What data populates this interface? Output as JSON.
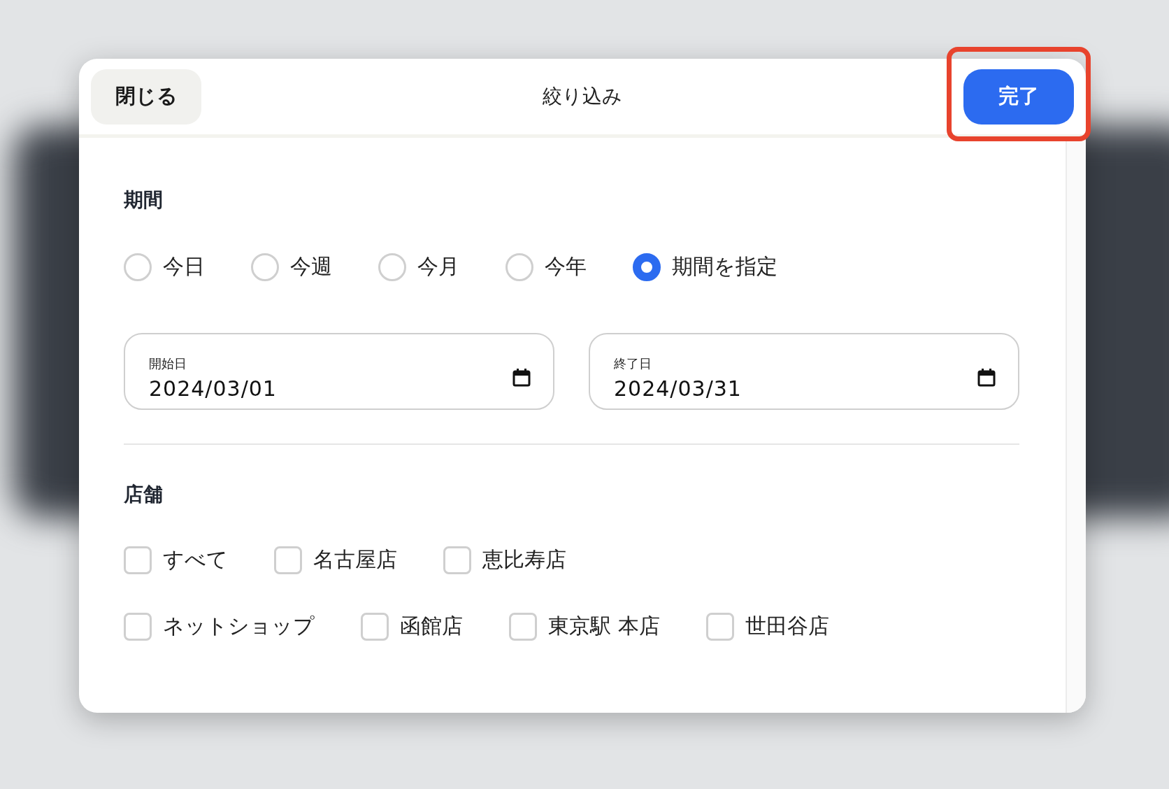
{
  "dialog": {
    "title": "絞り込み",
    "close_button": "閉じる",
    "done_button": {
      "label": "完了",
      "highlighted": true
    }
  },
  "period": {
    "heading": "期間",
    "options": [
      {
        "label": "今日",
        "selected": false
      },
      {
        "label": "今週",
        "selected": false
      },
      {
        "label": "今月",
        "selected": false
      },
      {
        "label": "今年",
        "selected": false
      },
      {
        "label": "期間を指定",
        "selected": true
      }
    ],
    "fields": [
      {
        "label": "開始日",
        "value": "2024/03/01"
      },
      {
        "label": "終了日",
        "value": "2024/03/31"
      }
    ]
  },
  "stores": {
    "heading": "店舗",
    "rows": [
      [
        {
          "label": "すべて",
          "checked": false
        },
        {
          "label": "名古屋店",
          "checked": false
        },
        {
          "label": "恵比寿店",
          "checked": false
        }
      ],
      [
        {
          "label": "ネットショップ",
          "checked": false
        },
        {
          "label": "函館店",
          "checked": false
        },
        {
          "label": "東京駅 本店",
          "checked": false
        },
        {
          "label": "世田谷店",
          "checked": false
        }
      ]
    ]
  }
}
